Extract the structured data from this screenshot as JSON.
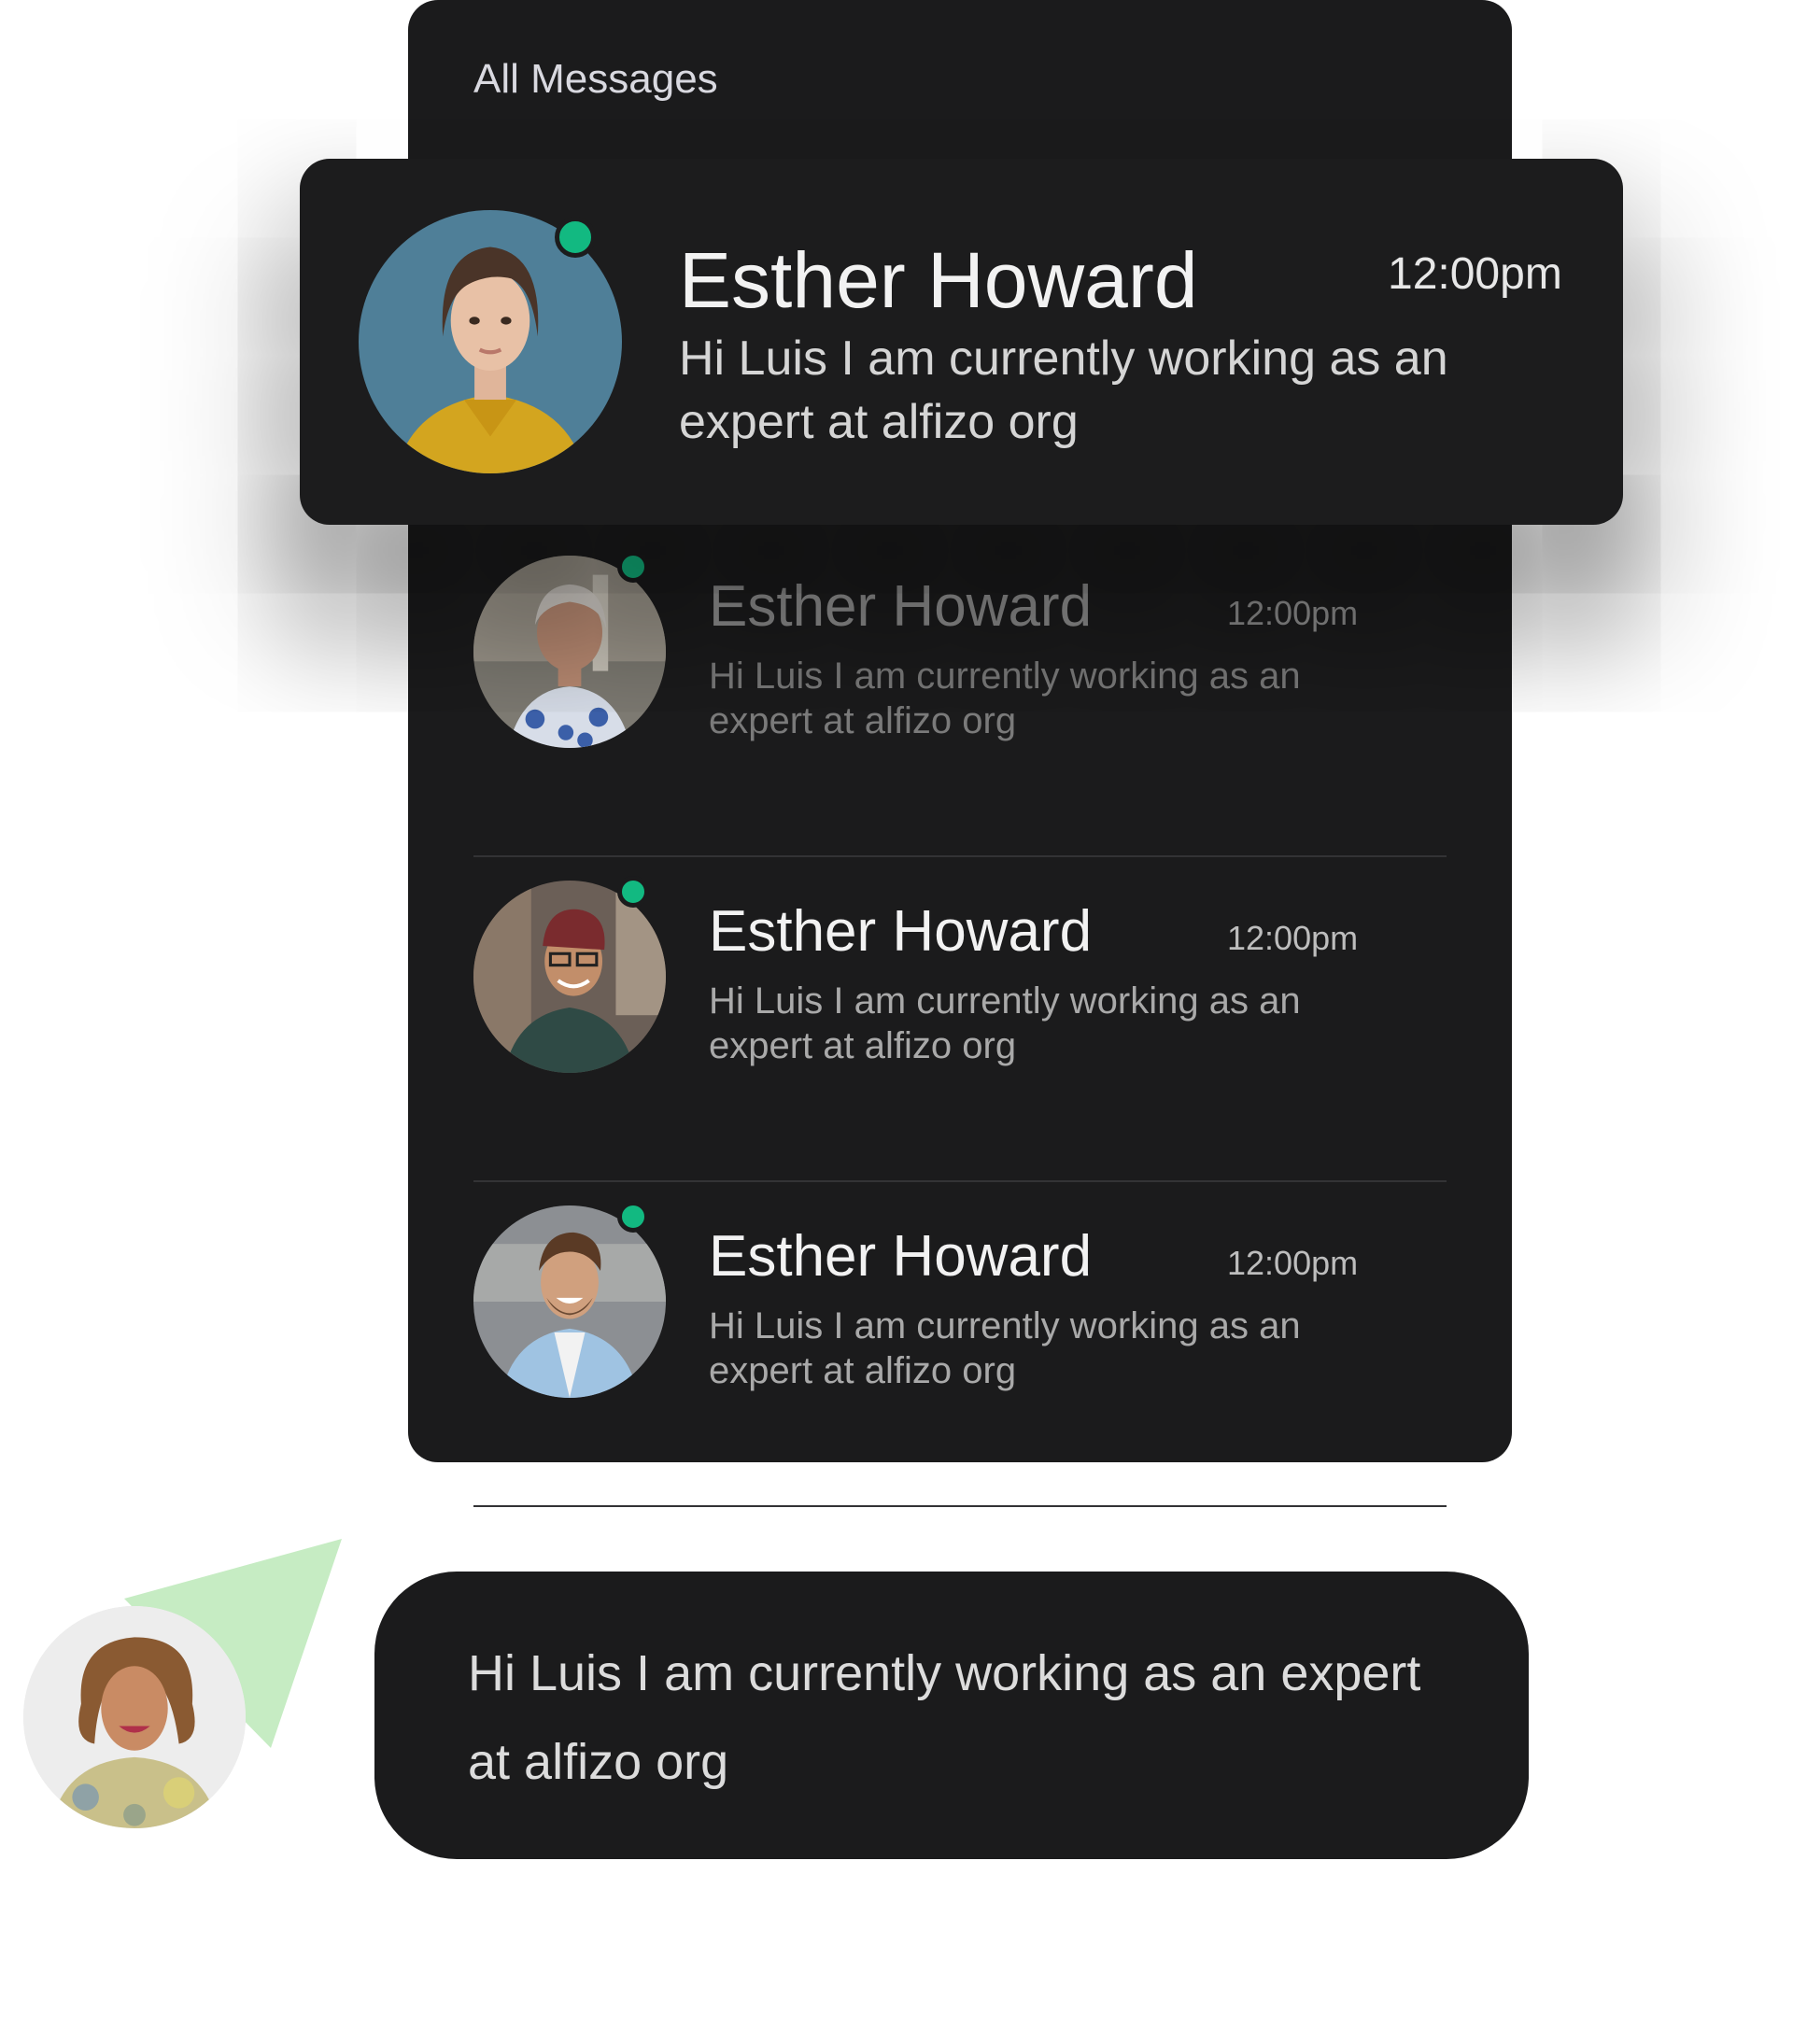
{
  "header": {
    "title": "All Messages"
  },
  "featured": {
    "name": "Esther Howard",
    "time": "12:00pm",
    "message": "Hi Luis I am currently working as an expert at alfizo org"
  },
  "conversations": [
    {
      "name": "Esther Howard",
      "time": "12:00pm",
      "message": "Hi Luis I am currently working as an expert at alfizo org"
    },
    {
      "name": "Esther Howard",
      "time": "12:00pm",
      "message": "Hi Luis I am currently working as an expert at alfizo org"
    },
    {
      "name": "Esther Howard",
      "time": "12:00pm",
      "message": "Hi Luis I am currently working as an expert at alfizo org"
    }
  ],
  "chat_bubble": {
    "message": "Hi Luis I am currently working as an expert at alfizo org"
  },
  "colors": {
    "panel_bg": "#1b1b1c",
    "online_dot": "#12b981",
    "send_triangle": "#c6ecc3"
  },
  "icons": {
    "status": "online-dot-icon",
    "send": "send-arrow-icon"
  }
}
